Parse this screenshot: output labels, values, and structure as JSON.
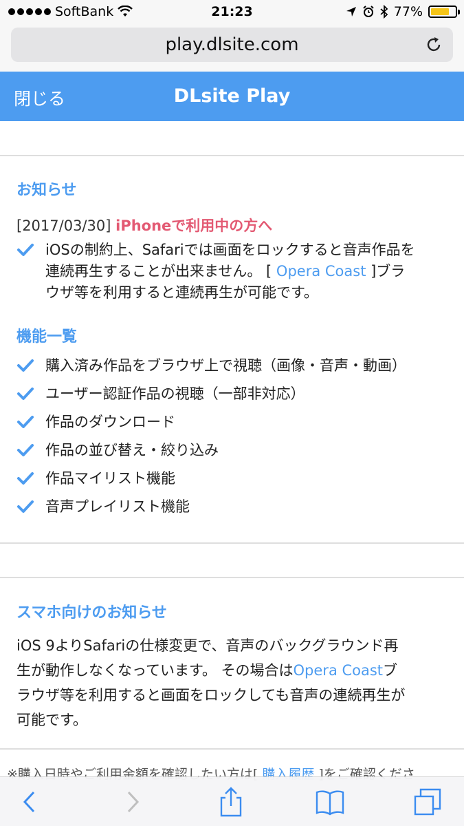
{
  "statusbar": {
    "carrier": "SoftBank",
    "time": "21:23",
    "battery": "77%",
    "battery_level": 0.77
  },
  "urlbar": {
    "url": "play.dlsite.com"
  },
  "appbar": {
    "close_label": "閉じる",
    "title": "DLsite Play"
  },
  "notice": {
    "title": "お知らせ",
    "date": "[2017/03/30]",
    "headline": "iPhoneで利用中の方へ",
    "body_line1": "iOSの制約上、Safariでは画面をロックすると音声作品を",
    "body_line2_a": "連続再生することが出来ません。 [ ",
    "body_link": "Opera Coast",
    "body_line2_b": " ]ブラ",
    "body_line3": "ウザ等を利用すると連続再生が可能です。"
  },
  "features": {
    "title": "機能一覧",
    "items": [
      "購入済み作品をブラウザ上で視聴（画像・音声・動画）",
      "ユーザー認証作品の視聴（一部非対応）",
      "作品のダウンロード",
      "作品の並び替え・絞り込み",
      "作品マイリスト機能",
      "音声プレイリスト機能"
    ]
  },
  "smartphone": {
    "title": "スマホ向けのお知らせ",
    "line1": "iOS 9よりSafariの仕様変更で、音声のバックグラウンド再",
    "line2_a": "生が動作しなくなっています。 その場合は",
    "link": "Opera Coast",
    "line2_b": "ブ",
    "line3": "ラウザ等を利用すると画面をロックしても音声の連続再生が",
    "line4": "可能です。"
  },
  "footnote": {
    "text_a": "※購入日時やご利用金額を確認したい方は[ ",
    "link": "購入履歴",
    "text_b": " ]をご確認くださ"
  },
  "colors": {
    "accent": "#4d9cf0",
    "highlight": "#e35a73"
  }
}
